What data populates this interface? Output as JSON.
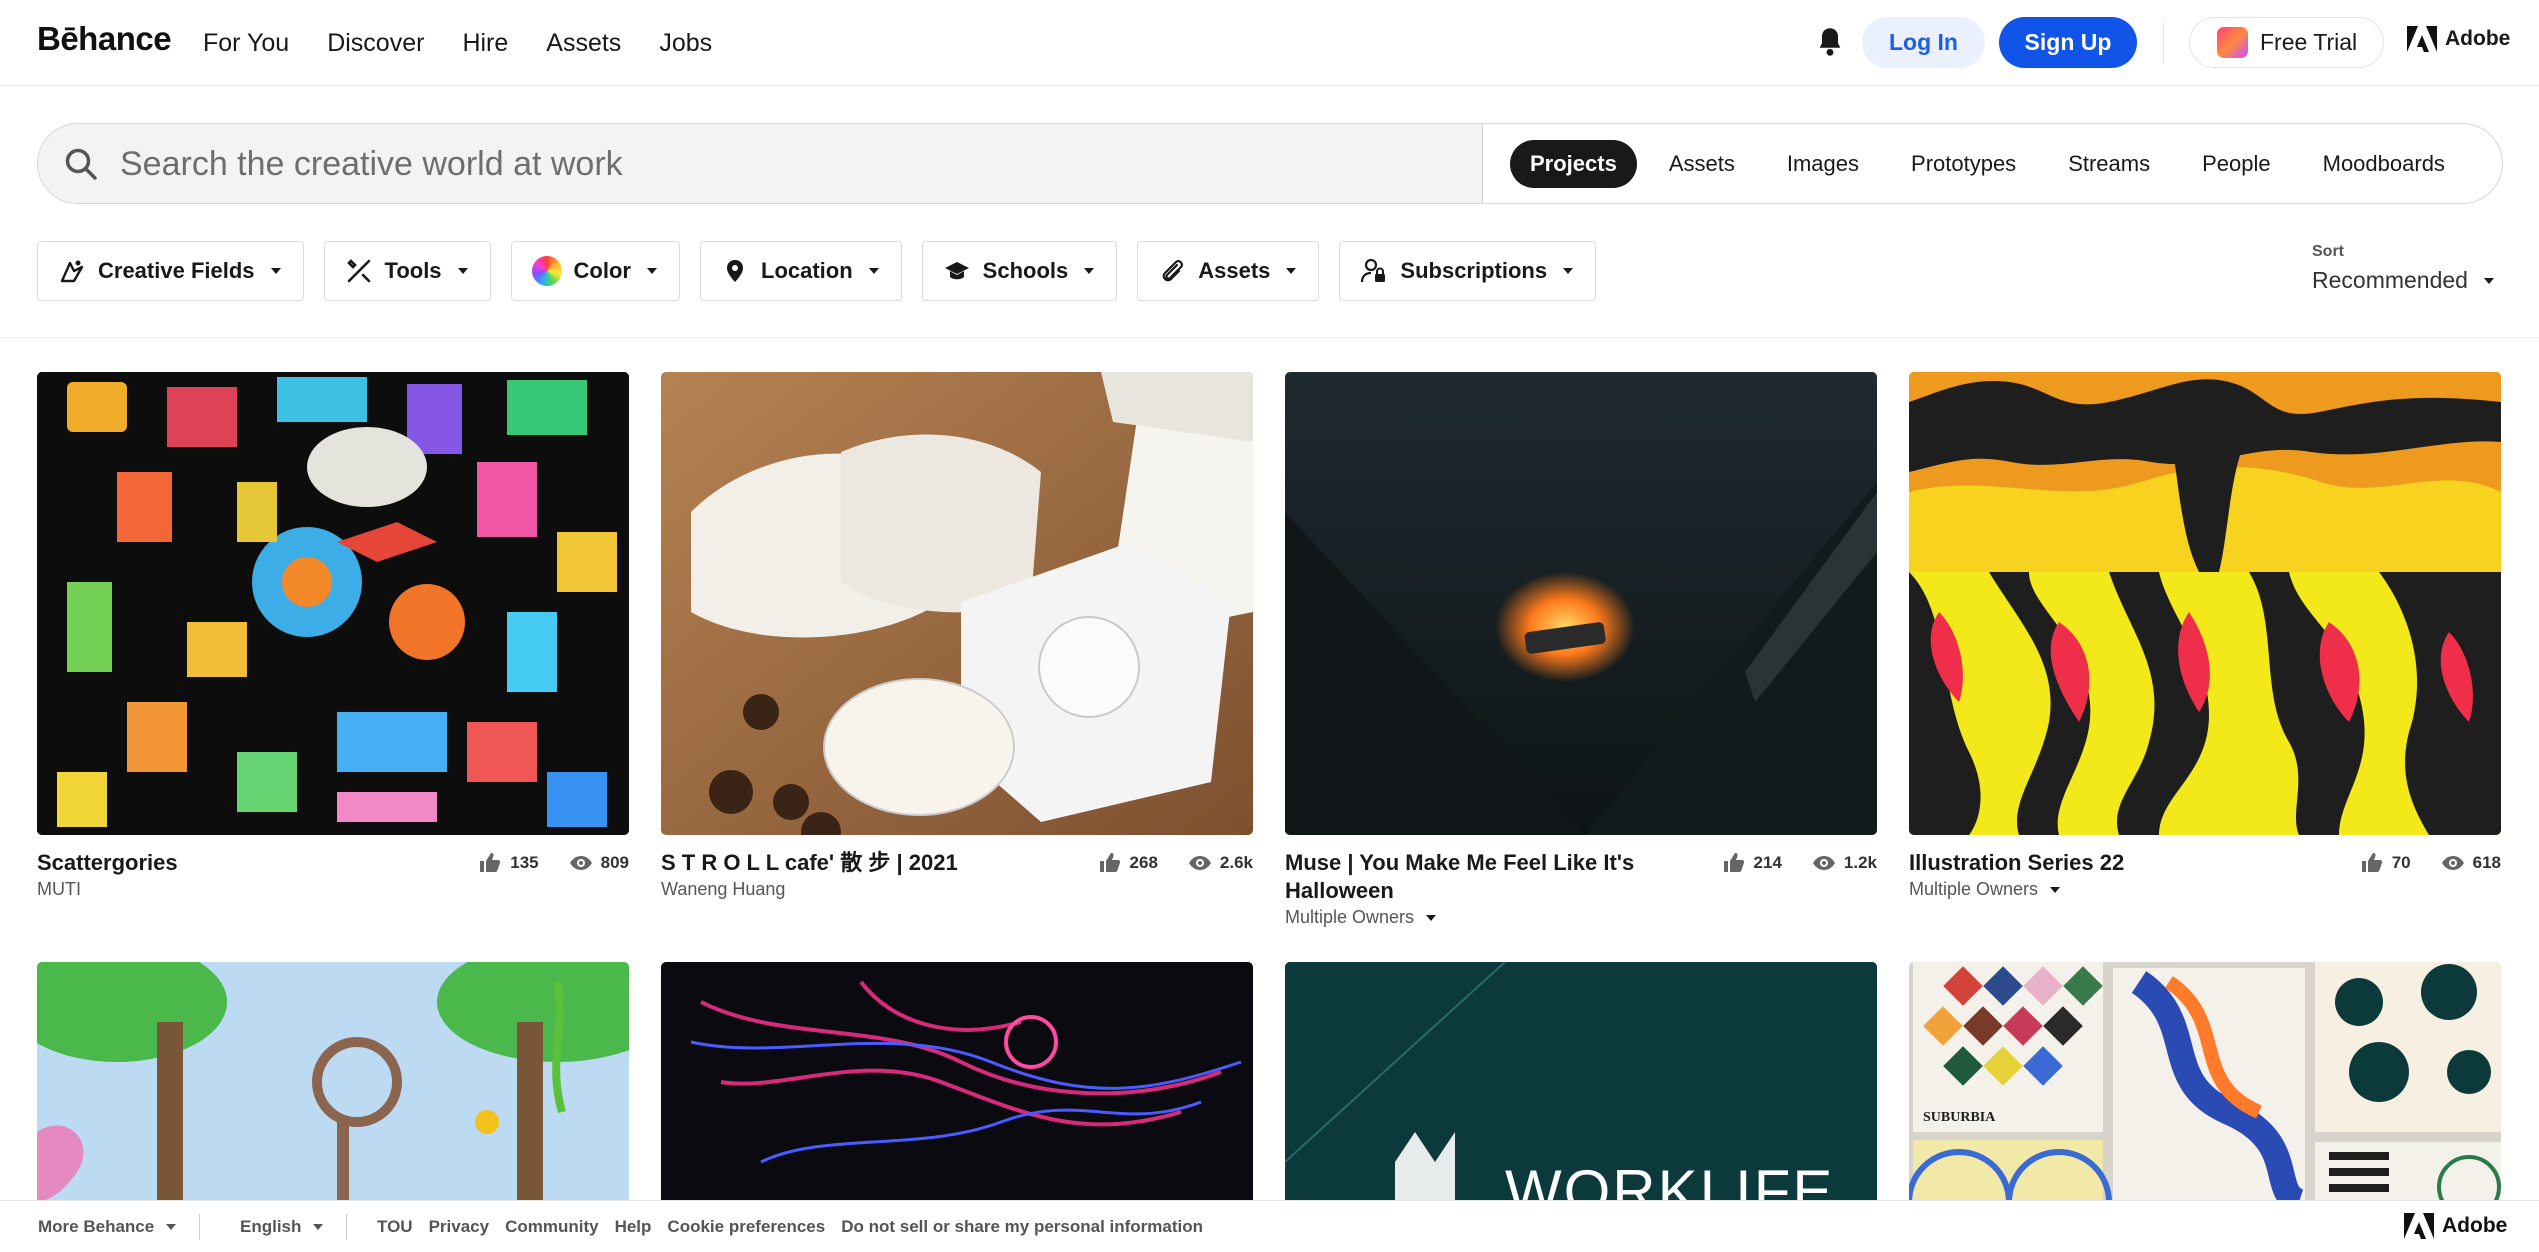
{
  "brand": {
    "logo": "Bēhance"
  },
  "nav": {
    "links": [
      "For You",
      "Discover",
      "Hire",
      "Assets",
      "Jobs"
    ]
  },
  "header": {
    "login": "Log In",
    "signup": "Sign Up",
    "trial": "Free Trial",
    "adobe": "Adobe"
  },
  "search": {
    "placeholder": "Search the creative world at work",
    "scopes": [
      "Projects",
      "Assets",
      "Images",
      "Prototypes",
      "Streams",
      "People",
      "Moodboards"
    ],
    "active_scope": "Projects"
  },
  "filters": [
    "Creative Fields",
    "Tools",
    "Color",
    "Location",
    "Schools",
    "Assets",
    "Subscriptions"
  ],
  "sort": {
    "label": "Sort",
    "value": "Recommended"
  },
  "projects": [
    {
      "title": "Scattergories",
      "owner": "MUTI",
      "likes": "135",
      "views": "809",
      "multiple_owners": false
    },
    {
      "title": "S T R O L L cafe' 散 步 | 2021",
      "owner": "Waneng Huang",
      "likes": "268",
      "views": "2.6k",
      "multiple_owners": false
    },
    {
      "title": "Muse | You Make Me Feel Like It's Halloween",
      "owner": "Multiple Owners",
      "likes": "214",
      "views": "1.2k",
      "multiple_owners": true
    },
    {
      "title": "Illustration Series 22",
      "owner": "Multiple Owners",
      "likes": "70",
      "views": "618",
      "multiple_owners": true
    }
  ],
  "second_row": {
    "tile3_text": "WORKLIFE",
    "tile4_text": "SUBURBIA"
  },
  "footer": {
    "more": "More Behance",
    "language": "English",
    "links": [
      "TOU",
      "Privacy",
      "Community",
      "Help",
      "Cookie preferences",
      "Do not sell or share my personal information"
    ],
    "adobe": "Adobe"
  },
  "colors": {
    "accent": "#1054e8",
    "login_bg": "#eaf0fd"
  }
}
